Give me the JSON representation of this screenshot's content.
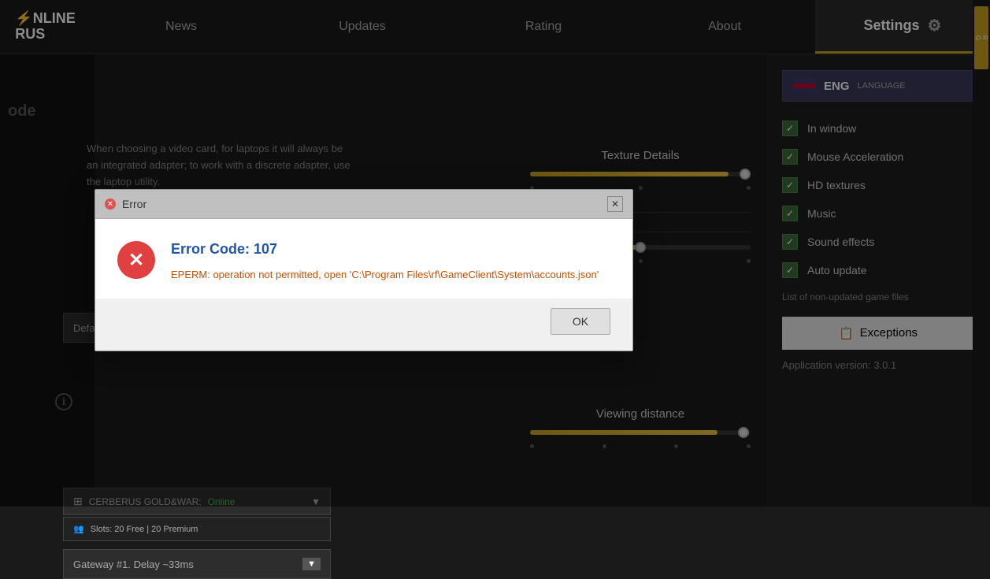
{
  "nav": {
    "logo_line1": "NLINE",
    "logo_line2": "RUS",
    "items": [
      {
        "id": "news",
        "label": "News",
        "active": false
      },
      {
        "id": "updates",
        "label": "Updates",
        "active": false
      },
      {
        "id": "rating",
        "label": "Rating",
        "active": false
      },
      {
        "id": "about",
        "label": "About",
        "active": false
      },
      {
        "id": "settings",
        "label": "Settings",
        "active": true
      }
    ]
  },
  "left": {
    "info_text": "When choosing a video card, for laptops it will always be an integrated adapter; to work with a discrete adapter, use the laptop utility.",
    "adapter_label": "Default%20Adapter",
    "server_name": "CERBERUS GOLD&WAR:",
    "server_status": "Online",
    "server_slots": "Slots: 20 Free | 20 Premium",
    "gateway_label": "Gateway #1. Delay ~33ms"
  },
  "middle": {
    "texture_label": "Texture Details",
    "viewing_label": "Viewing distance"
  },
  "settings": {
    "lang_code": "ENG",
    "lang_label": "LANGUAGE",
    "checkboxes": [
      {
        "id": "in_window",
        "label": "In window",
        "checked": true
      },
      {
        "id": "mouse_accel",
        "label": "Mouse Acceleration",
        "checked": true
      },
      {
        "id": "hd_textures",
        "label": "HD textures",
        "checked": true
      },
      {
        "id": "music",
        "label": "Music",
        "checked": true
      },
      {
        "id": "sound_effects",
        "label": "Sound effects",
        "checked": true
      },
      {
        "id": "auto_update",
        "label": "Auto update",
        "checked": true
      }
    ],
    "non_updated_link": "List of non-updated game files",
    "exceptions_label": "Exceptions",
    "app_version_label": "Application version: 3.0.1"
  },
  "dialog": {
    "title": "Error",
    "error_code_label": "Error Code: 107",
    "error_message": "EPERM: operation not permitted, open 'C:\\Program Files\\rf\\GameClient\\System\\accounts.json'",
    "ok_label": "OK"
  }
}
